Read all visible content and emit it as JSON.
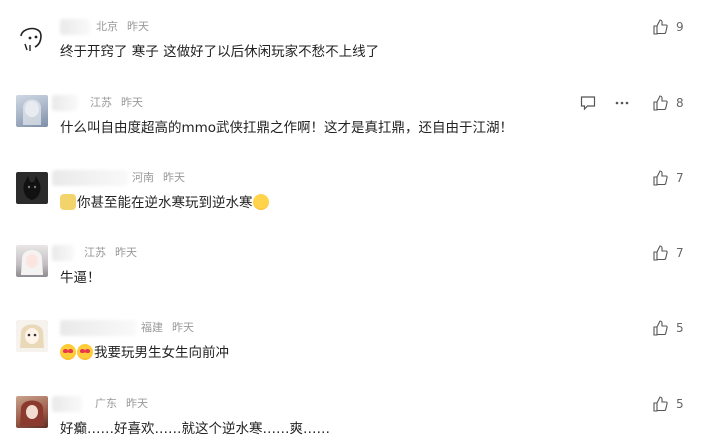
{
  "comments": [
    {
      "location": "北京",
      "time": "昨天",
      "text": "终于开窍了 寒子 这做好了以后休闲玩家不愁不上线了",
      "likes": "9",
      "avatar": "sketch-face"
    },
    {
      "location": "江苏",
      "time": "昨天",
      "text": "什么叫自由度超高的mmo武侠扛鼎之作啊！这才是真扛鼎，还自由于江湖！",
      "likes": "8",
      "avatar": "anime-girl-light"
    },
    {
      "location": "河南",
      "time": "昨天",
      "text": "你甚至能在逆水寒玩到逆水寒",
      "likes": "7",
      "avatar": "dark-cat"
    },
    {
      "location": "江苏",
      "time": "昨天",
      "text": "牛逼！",
      "likes": "7",
      "avatar": "anime-white-hair"
    },
    {
      "location": "福建",
      "time": "昨天",
      "text": "我要玩男生女生向前冲",
      "likes": "5",
      "avatar": "anime-doll"
    },
    {
      "location": "广东",
      "time": "昨天",
      "text": "好癫……好喜欢……就这个逆水寒……爽……",
      "likes": "5",
      "avatar": "anime-red-hair"
    }
  ],
  "icons": {
    "like": "thumbs-up-icon",
    "reply": "comment-icon",
    "more": "more-dots-icon"
  }
}
